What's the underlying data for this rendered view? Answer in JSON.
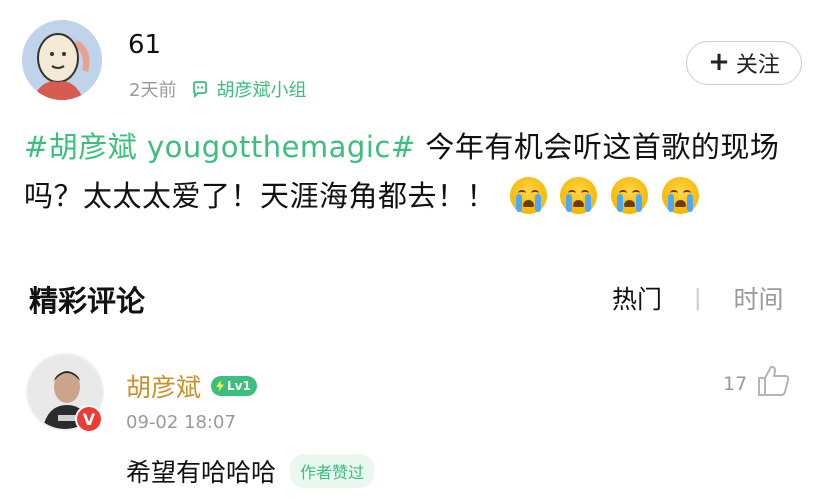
{
  "post": {
    "username": "61",
    "time_ago": "2天前",
    "group_name": "胡彦斌小组",
    "follow_label": "关注",
    "hashtag": "#胡彦斌 yougotthemagic#",
    "content": " 今年有机会听这首歌的现场吗？太太太爱了！天涯海角都去！！",
    "emojis": [
      "loudly-crying-face",
      "loudly-crying-face",
      "loudly-crying-face",
      "loudly-crying-face"
    ]
  },
  "comments_section": {
    "title": "精彩评论",
    "sort_hot": "热门",
    "sort_divider": "|",
    "sort_time": "时间"
  },
  "comment": {
    "username": "胡彦斌",
    "level": "Lv1",
    "verified_badge": "V",
    "time": "09-02 18:07",
    "like_count": "17",
    "text": "希望有哈哈哈",
    "author_liked": "作者赞过"
  },
  "colors": {
    "accent_green": "#3bbf7c",
    "username_gold": "#c9902c",
    "verified_red": "#ee3b36",
    "meta_gray": "#9a9a9a"
  }
}
